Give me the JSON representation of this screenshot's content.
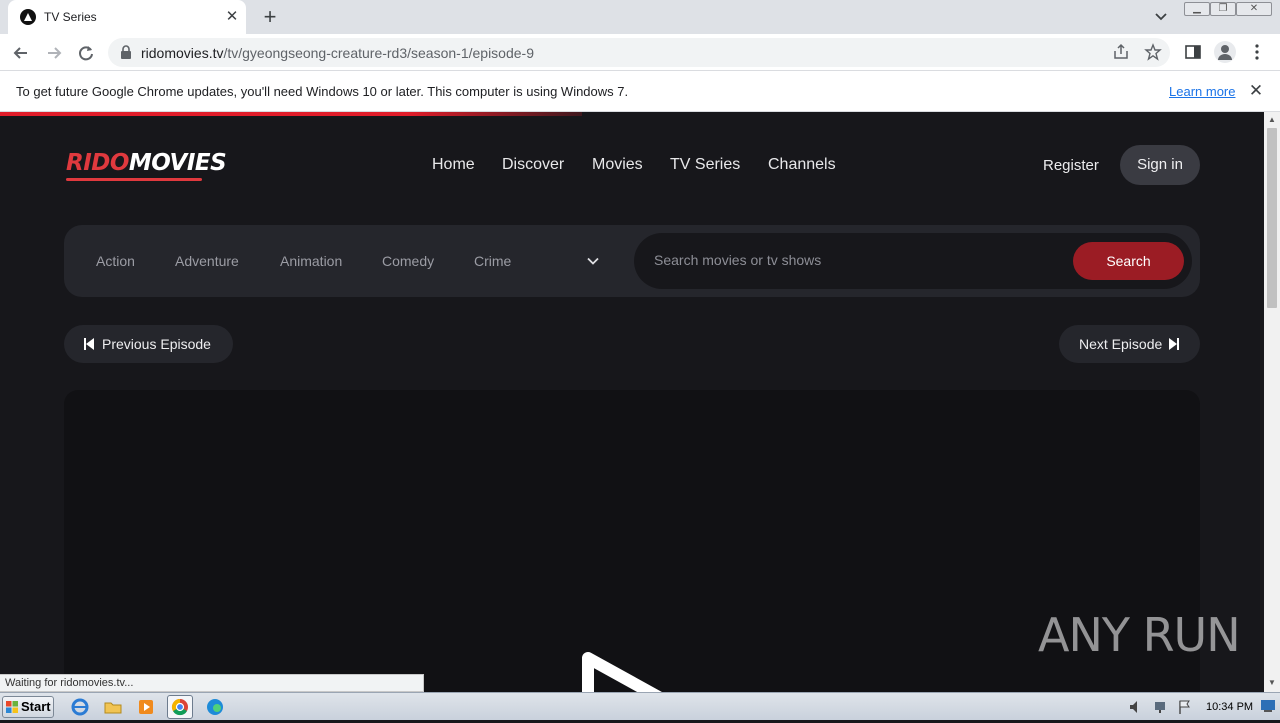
{
  "browser": {
    "tab_title": "TV Series",
    "url_host": "ridomovies.tv",
    "url_path": "/tv/gyeongseong-creature-rd3/season-1/episode-9",
    "infobar_text": "To get future Google Chrome updates, you'll need Windows 10 or later. This computer is using Windows 7.",
    "infobar_link": "Learn more",
    "status_text": "Waiting for ridomovies.tv..."
  },
  "site": {
    "logo_part1": "RIDO",
    "logo_part2": "MOVIES",
    "nav": [
      "Home",
      "Discover",
      "Movies",
      "TV Series",
      "Channels"
    ],
    "register": "Register",
    "signin": "Sign in",
    "genres": [
      "Action",
      "Adventure",
      "Animation",
      "Comedy",
      "Crime"
    ],
    "search_placeholder": "Search movies or tv shows",
    "search_button": "Search",
    "prev_episode": "Previous Episode",
    "next_episode": "Next Episode",
    "accent_color": "#9b1c24"
  },
  "watermark": "ANY RUN",
  "taskbar": {
    "start": "Start",
    "clock": "10:34 PM"
  }
}
